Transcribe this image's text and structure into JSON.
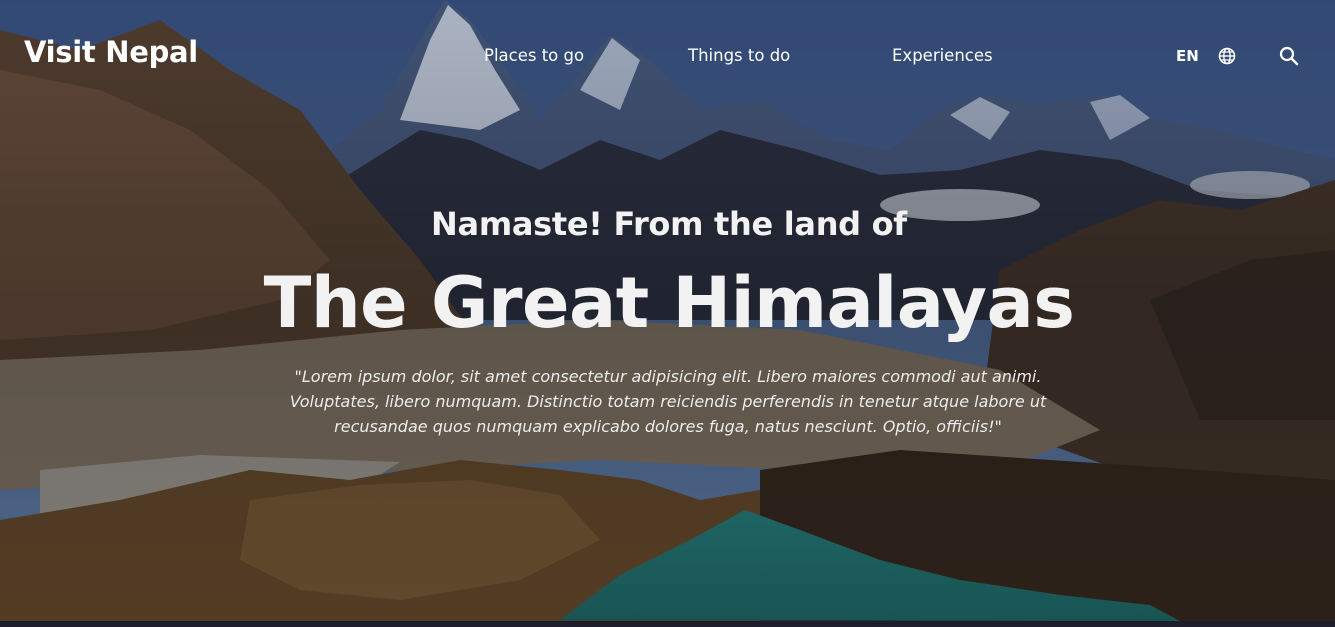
{
  "header": {
    "logo": "Visit Nepal",
    "nav": [
      {
        "label": "Places to go"
      },
      {
        "label": "Things to do"
      },
      {
        "label": "Experiences"
      }
    ],
    "language": "EN",
    "globe_icon": "globe-icon",
    "search_icon": "search-icon"
  },
  "hero": {
    "subtitle": "Namaste! From the land of",
    "title": "The Great Himalayas",
    "description": "\"Lorem ipsum dolor, sit amet consectetur adipisicing elit. Libero maiores commodi aut animi. Voluptates, libero numquam. Distinctio totam reiciendis perferendis in tenetur atque labore ut recusandae quos numquam explicabo dolores fuga, natus nesciunt. Optio, officiis!\"",
    "background": "mountain lake landscape",
    "colors": {
      "sky": "#4a6a9c",
      "lake": "#2f8b86",
      "text": "#f2f2f2"
    }
  }
}
